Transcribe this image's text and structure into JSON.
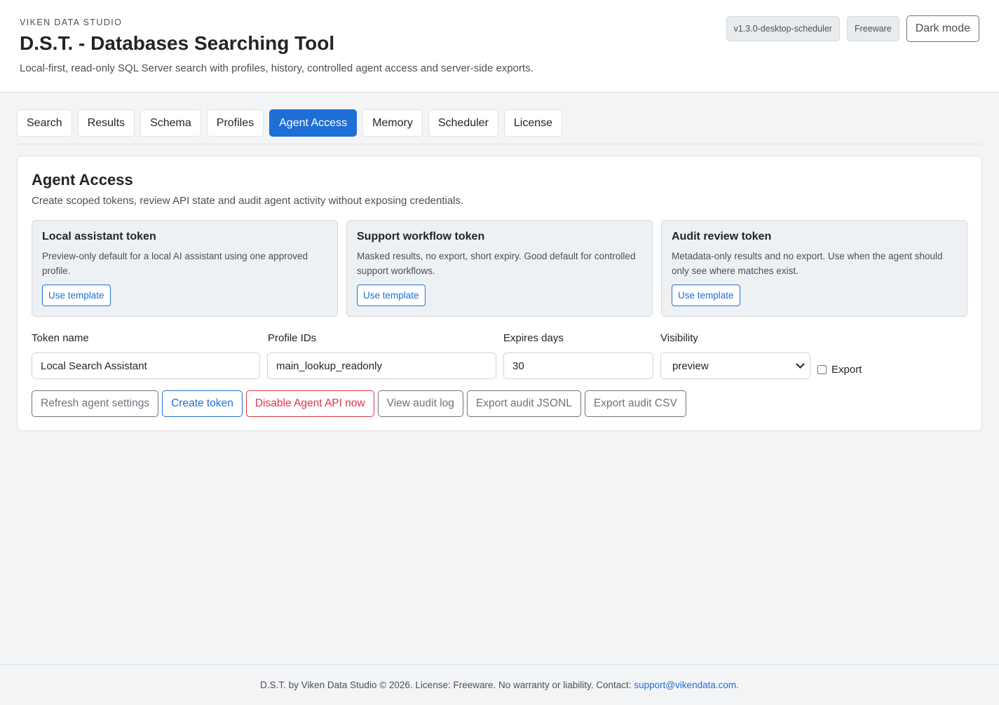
{
  "header": {
    "kicker": "VIKEN DATA STUDIO",
    "title": "D.S.T. - Databases Searching Tool",
    "subtitle": "Local-first, read-only SQL Server search with profiles, history, controlled agent access and server-side exports.",
    "version_badge": "v1.3.0-desktop-scheduler",
    "license_badge": "Freeware",
    "dark_mode_label": "Dark mode"
  },
  "tabs": [
    {
      "label": "Search",
      "active": false
    },
    {
      "label": "Results",
      "active": false
    },
    {
      "label": "Schema",
      "active": false
    },
    {
      "label": "Profiles",
      "active": false
    },
    {
      "label": "Agent Access",
      "active": true
    },
    {
      "label": "Memory",
      "active": false
    },
    {
      "label": "Scheduler",
      "active": false
    },
    {
      "label": "License",
      "active": false
    }
  ],
  "panel": {
    "title": "Agent Access",
    "description": "Create scoped tokens, review API state and audit agent activity without exposing credentials.",
    "templates": [
      {
        "title": "Local assistant token",
        "description": "Preview-only default for a local AI assistant using one approved profile.",
        "button_label": "Use template"
      },
      {
        "title": "Support workflow token",
        "description": "Masked results, no export, short expiry. Good default for controlled support workflows.",
        "button_label": "Use template"
      },
      {
        "title": "Audit review token",
        "description": "Metadata-only results and no export. Use when the agent should only see where matches exist.",
        "button_label": "Use template"
      }
    ],
    "form": {
      "token_name_label": "Token name",
      "token_name_value": "Local Search Assistant",
      "profile_ids_label": "Profile IDs",
      "profile_ids_value": "main_lookup_readonly",
      "expires_days_label": "Expires days",
      "expires_days_value": "30",
      "visibility_label": "Visibility",
      "visibility_value": "preview",
      "export_label": "Export",
      "export_checked": false
    },
    "actions": {
      "refresh": "Refresh agent settings",
      "create": "Create token",
      "disable": "Disable Agent API now",
      "view_audit": "View audit log",
      "export_jsonl": "Export audit JSONL",
      "export_csv": "Export audit CSV"
    }
  },
  "footer": {
    "text": "D.S.T. by Viken Data Studio © 2026. License: Freeware. No warranty or liability. Contact:",
    "email": "support@vikendata.com",
    "trailing": "."
  },
  "colors": {
    "accent": "#1f6fd6",
    "danger": "#dc3545",
    "background": "#f3f4f6"
  }
}
